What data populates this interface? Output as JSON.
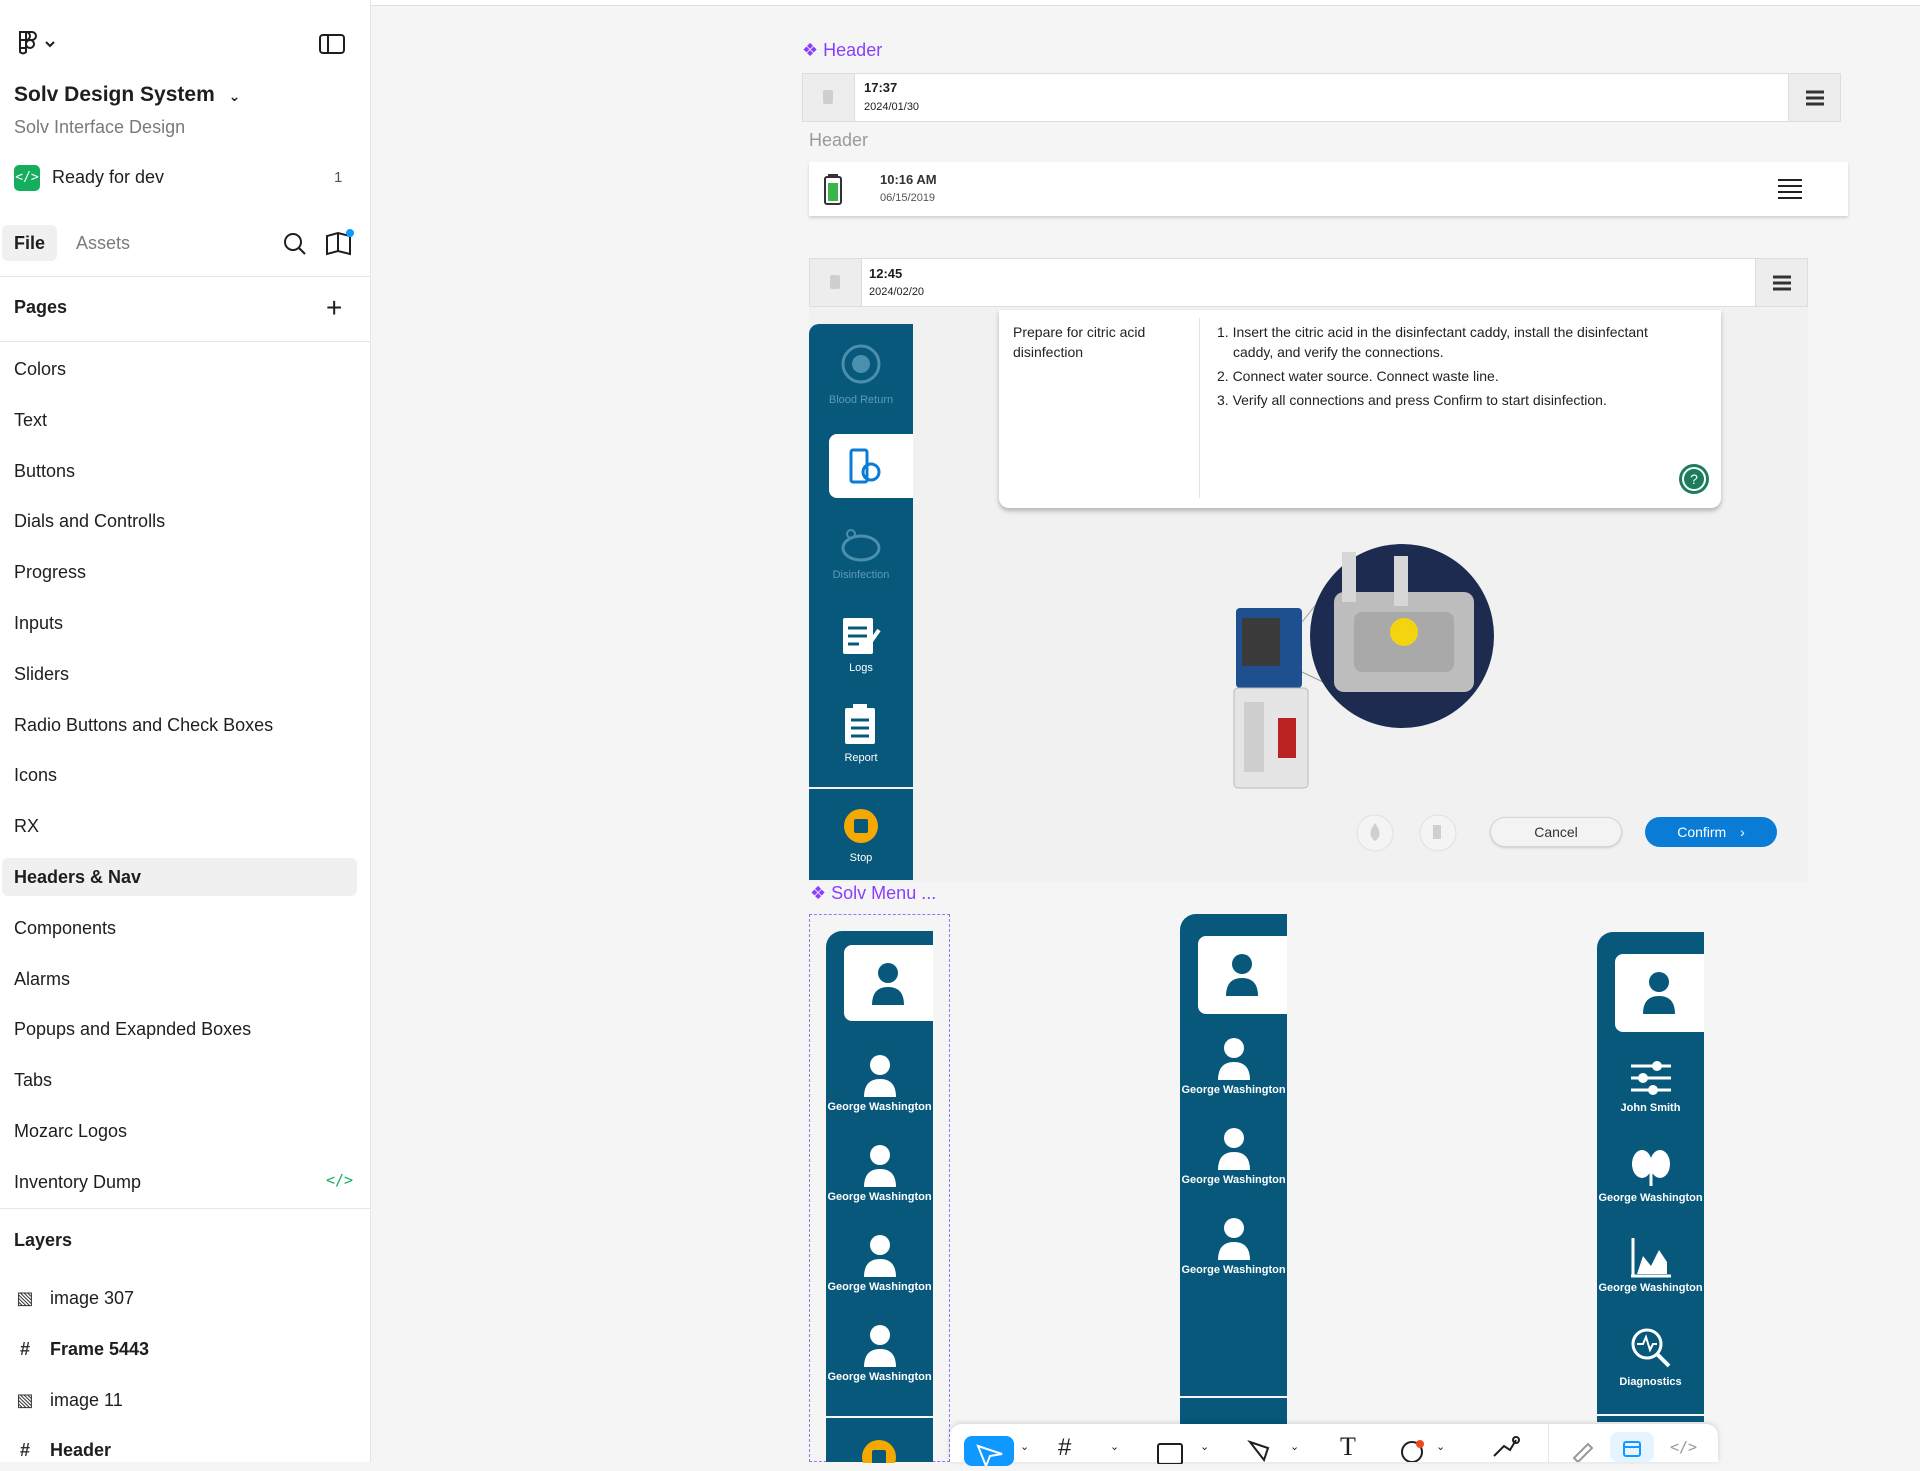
{
  "sidebar": {
    "logo_icon": "figma-logo-icon",
    "file_title": "Solv Design System",
    "project": "Solv Interface Design",
    "dev_status": {
      "label": "Ready for dev",
      "count": "1"
    },
    "tabs": {
      "file": "File",
      "assets": "Assets"
    },
    "pages_heading": "Pages",
    "pages": [
      "Colors",
      "Text",
      "Buttons",
      "Dials and Controlls",
      "Progress",
      "Inputs",
      "Sliders",
      "Radio Buttons and Check Boxes",
      "Icons",
      "RX",
      "Headers & Nav",
      "Components",
      "Alarms",
      "Popups and Exapnded Boxes",
      "Tabs",
      "Mozarc Logos",
      "Inventory Dump"
    ],
    "selected_page": "Headers & Nav",
    "layers_heading": "Layers",
    "layers": [
      {
        "name": "image 307",
        "type": "image"
      },
      {
        "name": "Frame 5443",
        "type": "frame"
      },
      {
        "name": "image 11",
        "type": "image"
      },
      {
        "name": "Header",
        "type": "frame"
      }
    ]
  },
  "canvas": {
    "header_component_label": "Header",
    "header1": {
      "time": "17:37",
      "date": "2024/01/30"
    },
    "header_frame_label": "Header",
    "header2": {
      "time": "10:16 AM",
      "date": "06/15/2019"
    },
    "screen": {
      "time": "12:45",
      "date": "2024/02/20",
      "nav": [
        "Blood Return",
        "",
        "Disinfection",
        "Logs",
        "Report",
        "Stop"
      ],
      "instruction_title": "Prepare for citric acid disinfection",
      "steps": [
        "1. Insert the citric acid in the disinfectant caddy, install the disinfectant caddy, and verify the connections.",
        "2. Connect water source. Connect waste line.",
        "3. Verify all connections and press Confirm to start disinfection."
      ],
      "cancel": "Cancel",
      "confirm": "Confirm"
    },
    "menu_component_label": "Solv Menu ...",
    "menu1": [
      "George Washington",
      "George Washington",
      "George Washington",
      "George Washington"
    ],
    "menu2": [
      "George Washington",
      "George Washington",
      "George Washington"
    ],
    "menu3": [
      "John Smith",
      "George Washington",
      "George Washington",
      "Diagnostics"
    ]
  },
  "colors": {
    "accent": "#8a3ffc",
    "navy": "#07587b",
    "confirm": "#0a7cd6",
    "dev_green": "#14ae5c",
    "selection": "#0d99ff"
  }
}
